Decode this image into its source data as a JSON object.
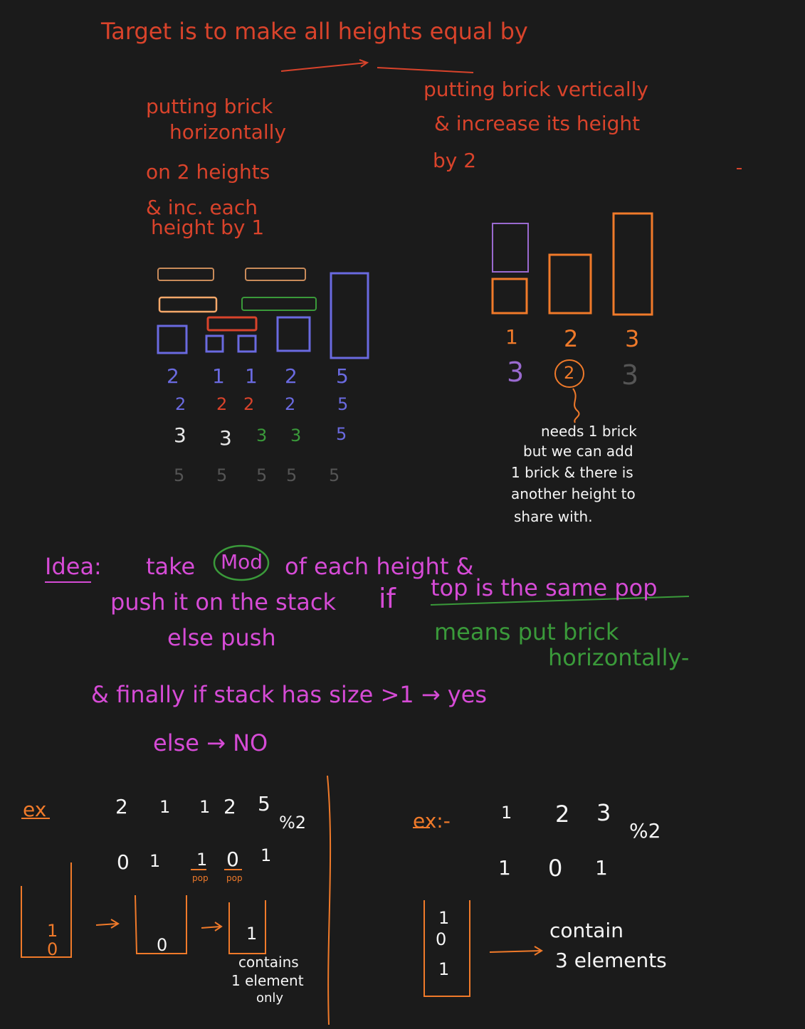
{
  "colors": {
    "background": "#1b1b1b",
    "red": "#d9432b",
    "orange": "#f07a2a",
    "orange_light": "#f5a86a",
    "magenta": "#d64bd6",
    "green": "#3a9a3a",
    "blue": "#6a6ae0",
    "purple": "#9a6ad0",
    "grey": "#9a9a9a",
    "white": "#e8e8e8"
  },
  "heading": {
    "line1": "Target is to make all heights equal by",
    "left_method": [
      "putting brick",
      "horizontally",
      "on 2 heights",
      "& inc. each",
      "height by 1"
    ],
    "right_method": [
      "putting brick vertically",
      "& increase its height",
      "by 2"
    ]
  },
  "left_example": {
    "rows": [
      [
        "2",
        "1",
        "1",
        "2",
        "5"
      ],
      [
        "2",
        "2",
        "2",
        "2",
        "5"
      ],
      [
        "3",
        "3",
        "3",
        "3",
        "5"
      ],
      [
        "5",
        "5",
        "5",
        "5",
        "5"
      ]
    ]
  },
  "right_example": {
    "labels": [
      "1",
      "2",
      "3"
    ],
    "second_row": [
      "3",
      "2",
      "3"
    ],
    "note": [
      "needs 1 brick",
      "but we can add",
      "1 brick & there is",
      "another height to",
      "share with."
    ]
  },
  "idea": {
    "label": "Idea:",
    "line1_pre": "take",
    "line1_mod": "Mod",
    "line1_post": "of each height &",
    "line2_pre": "push it on the stack",
    "line2_if": "if",
    "line2_cond": "top is the same pop",
    "line3": "else push",
    "green_note1": "means put brick",
    "green_note2": "horizontally-",
    "final1": "& finally if stack has size >1 → yes",
    "final2": "else → NO"
  },
  "example1": {
    "label": "ex",
    "values": [
      "2",
      "1",
      "1",
      "2",
      "5"
    ],
    "mod": "%2",
    "mods": [
      "0",
      "1",
      "1",
      "0",
      "1"
    ],
    "pop1": "pop",
    "pop2": "pop",
    "stack1": [
      "0",
      "1"
    ],
    "stack2": [
      "0"
    ],
    "stack3": [
      "1"
    ],
    "caption": [
      "contains",
      "1 element",
      "only"
    ]
  },
  "example2": {
    "label": "ex:-",
    "values": [
      "1",
      "2",
      "3"
    ],
    "mod": "%2",
    "mods": [
      "1",
      "0",
      "1"
    ],
    "stack": [
      "1",
      "0",
      "1"
    ],
    "caption": [
      "contain",
      "3 elements"
    ]
  }
}
